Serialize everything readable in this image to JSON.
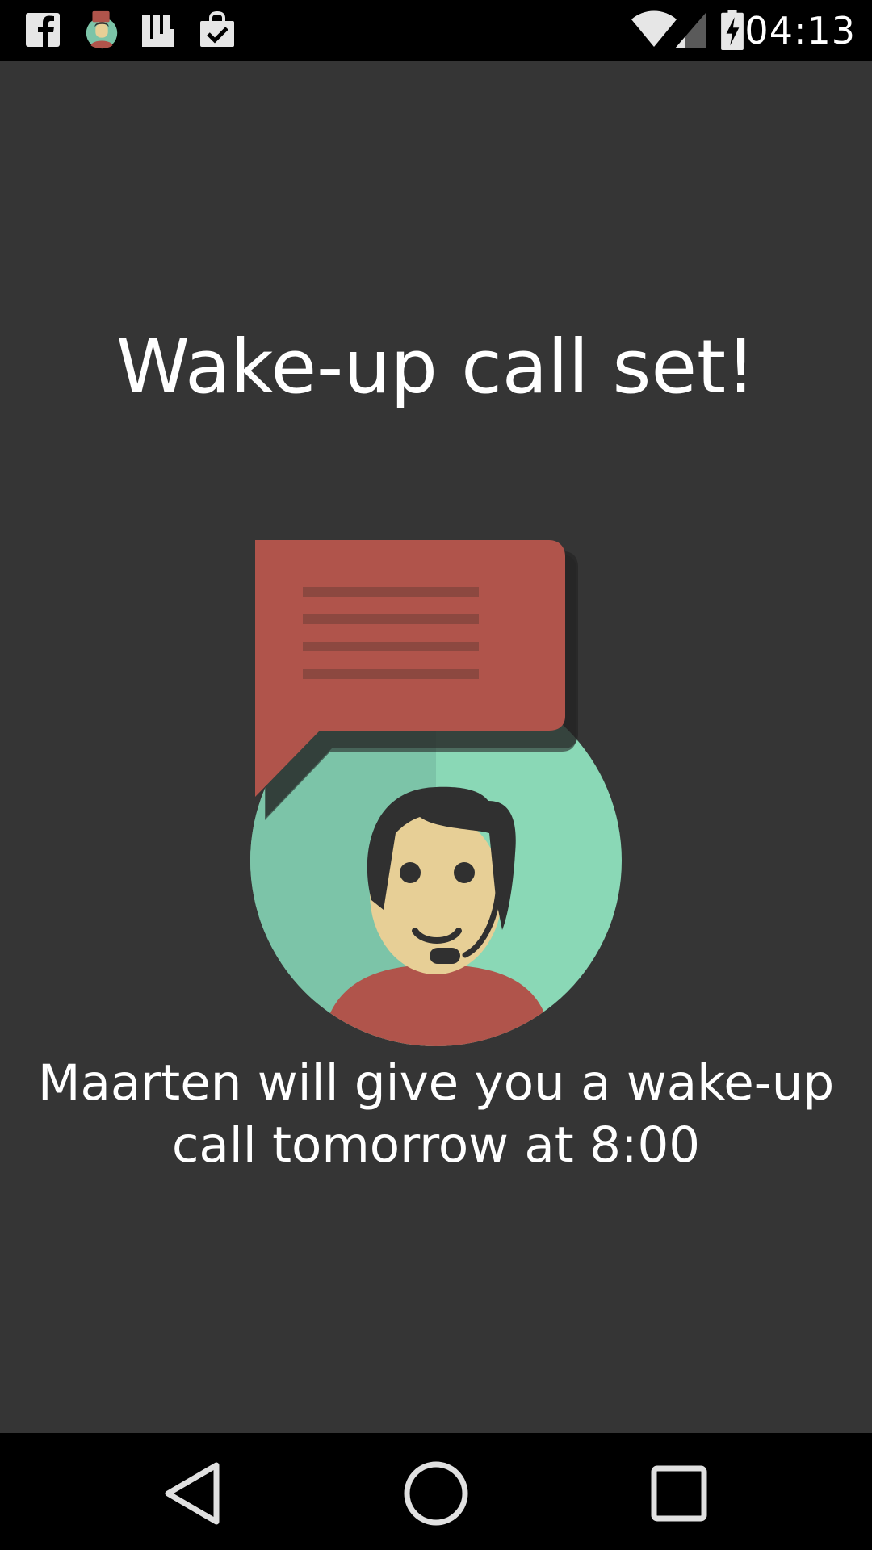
{
  "status_bar": {
    "time": "04:13",
    "notification_icons": [
      "facebook-icon",
      "app-avatar-icon",
      "line-app-icon",
      "shopping-bag-icon"
    ],
    "system_icons": [
      "wifi-icon",
      "cellular-signal-icon",
      "battery-charging-icon"
    ]
  },
  "main": {
    "title": "Wake-up call set!",
    "message": "Maarten will give you a wake-up call tomorrow at 8:00"
  },
  "nav_bar": {
    "buttons": [
      "back-icon",
      "home-icon",
      "recents-icon"
    ]
  },
  "colors": {
    "background": "#353535",
    "bubble": "#b0544b",
    "circle_light": "#8ad8b6",
    "circle_dark": "#7cc4a8",
    "face": "#e7cf96",
    "hair": "#303030",
    "shirt": "#b0544b"
  }
}
